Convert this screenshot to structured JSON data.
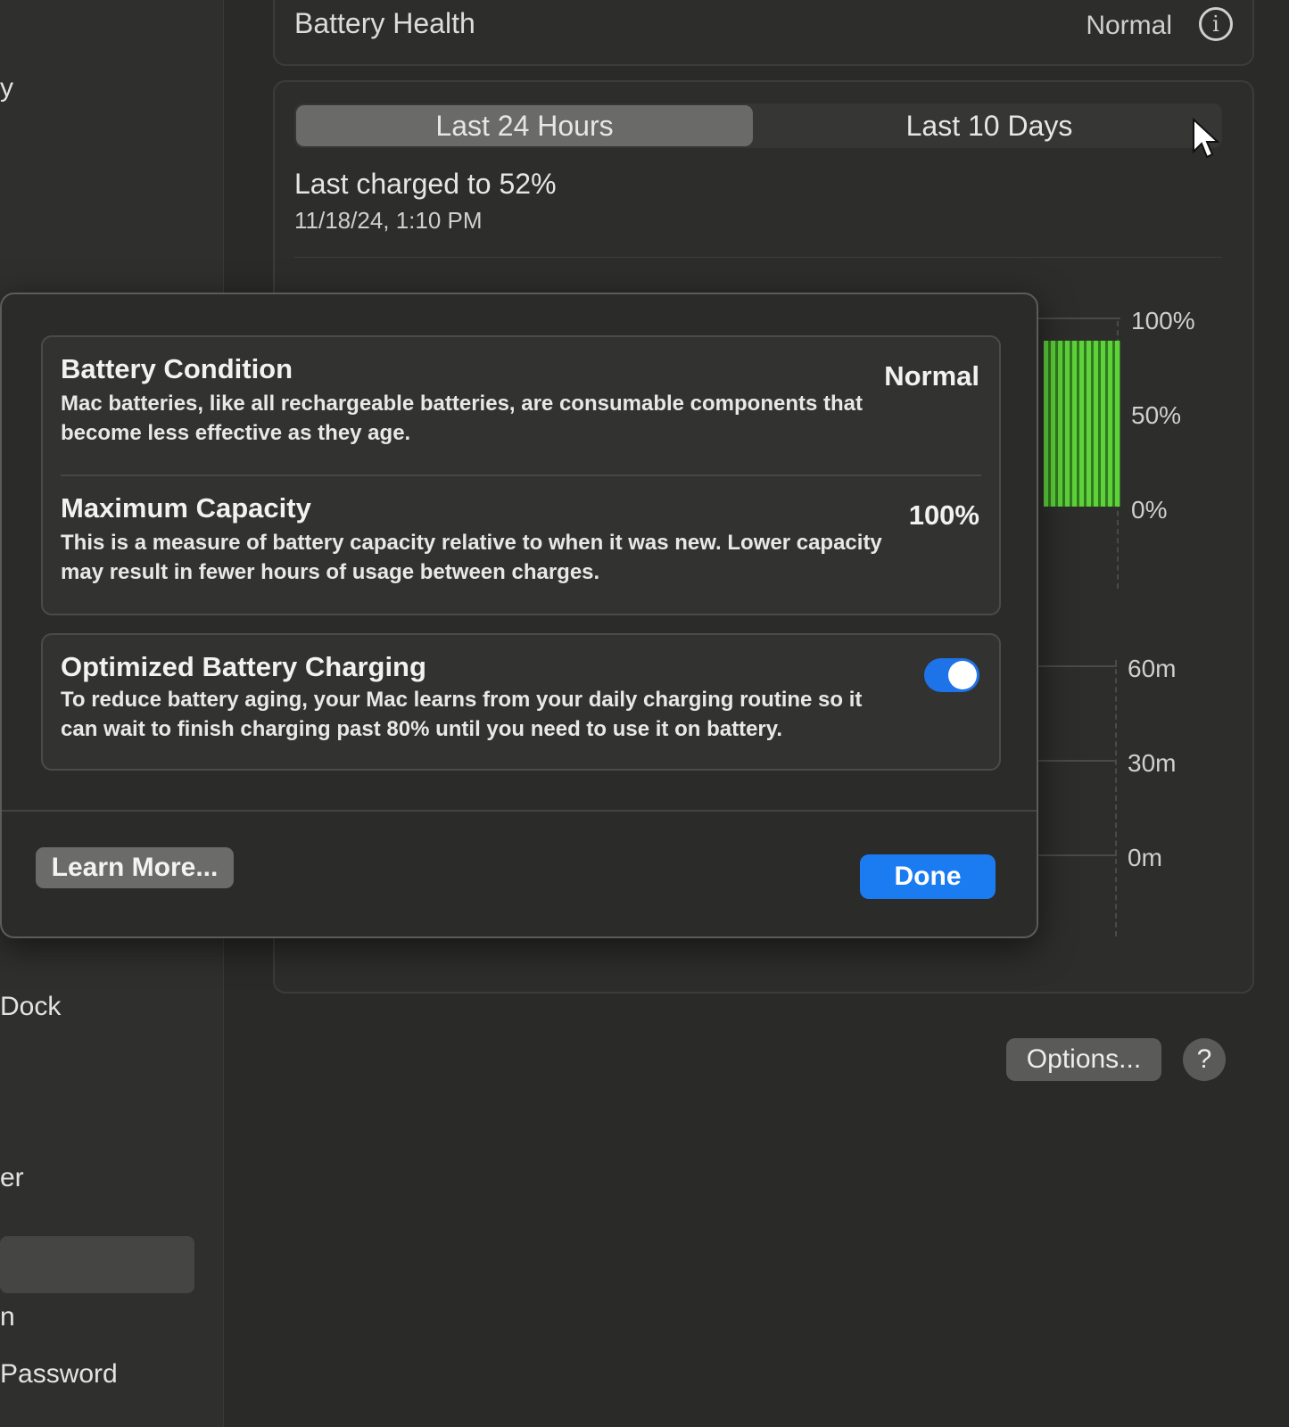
{
  "sidebar": {
    "partial_items": [
      "y",
      "Dock",
      "er",
      "n",
      "Password"
    ]
  },
  "battery_health": {
    "title": "Battery Health",
    "value": "Normal",
    "info_icon": "info-icon"
  },
  "usage": {
    "tabs": [
      {
        "label": "Last 24 Hours",
        "selected": true
      },
      {
        "label": "Last 10 Days",
        "selected": false
      }
    ],
    "last_charged": "Last charged to 52%",
    "last_charged_date": "11/18/24, 1:10 PM",
    "battery_axis": [
      "100%",
      "50%",
      "0%"
    ],
    "time_axis": [
      "60m",
      "30m",
      "0m"
    ],
    "bar_color": "#5fd13b"
  },
  "footer": {
    "options_label": "Options...",
    "help_label": "?"
  },
  "dialog": {
    "condition_title": "Battery Condition",
    "condition_value": "Normal",
    "condition_desc": "Mac batteries, like all rechargeable batteries, are consumable components that become less effective as they age.",
    "capacity_title": "Maximum Capacity",
    "capacity_value": "100%",
    "capacity_desc": "This is a measure of battery capacity relative to when it was new. Lower capacity may result in fewer hours of usage between charges.",
    "optimized_title": "Optimized Battery Charging",
    "optimized_desc": "To reduce battery aging, your Mac learns from your daily charging routine so it can wait to finish charging past 80% until you need to use it on battery.",
    "optimized_enabled": true,
    "learn_more_label": "Learn More...",
    "done_label": "Done",
    "accent": "#1b7bf0"
  }
}
